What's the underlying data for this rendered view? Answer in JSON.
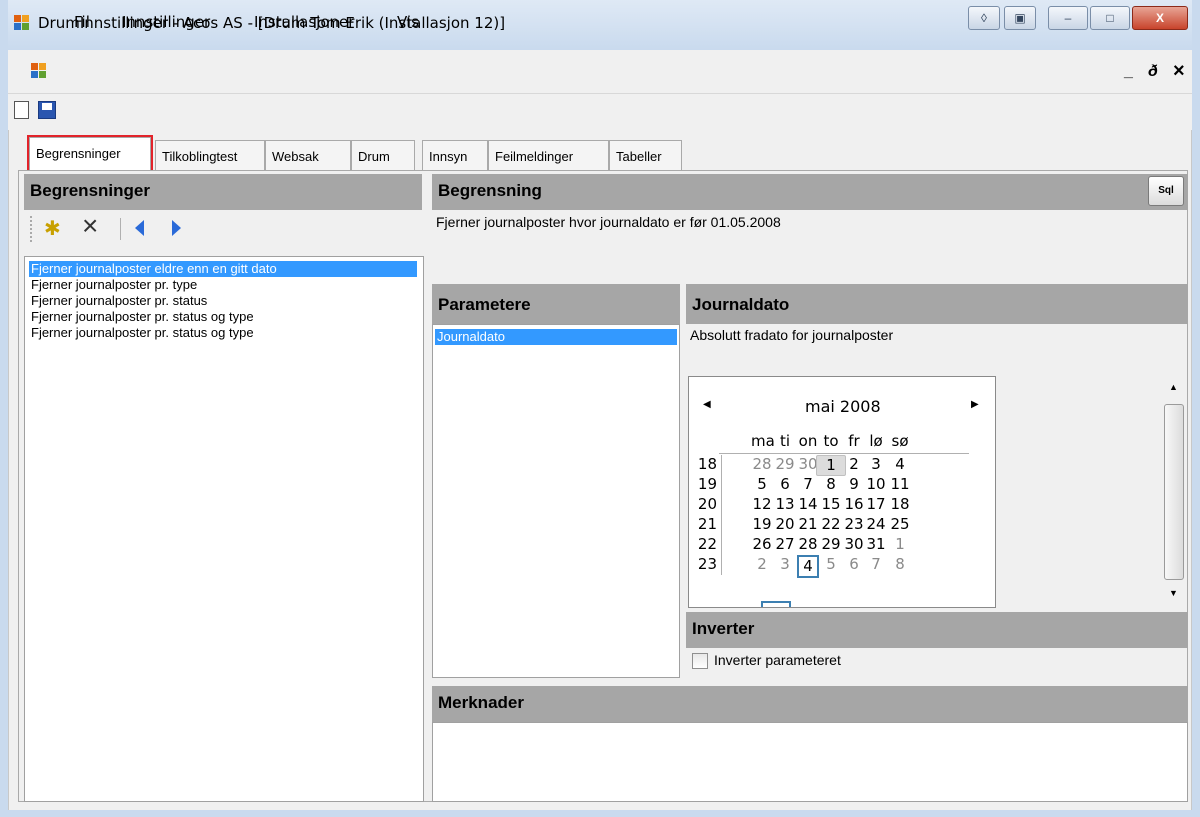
{
  "window": {
    "title": "DrumInnstillinger - Acos AS - [Drum Tom Erik (Installasjon 12)]",
    "close_glyph": "X",
    "minimize_glyph": "–",
    "maximize_glyph": "□"
  },
  "menu": {
    "items": [
      "Fil",
      "Innstillinger",
      "Installasjoner",
      "Vis"
    ],
    "mdi_controls": [
      "_",
      "ð",
      "×"
    ]
  },
  "tabs": [
    "Begrensninger",
    "Tilkoblingtest",
    "Websak",
    "Drum",
    "Innsyn",
    "Feilmeldinger",
    "Tabeller"
  ],
  "left_panel": {
    "header": "Begrensninger",
    "items": [
      "Fjerner journalposter eldre enn en gitt dato",
      "Fjerner journalposter pr. type",
      "Fjerner journalposter pr. status",
      "Fjerner journalposter pr. status og type",
      "Fjerner journalposter pr. status og type"
    ]
  },
  "begrensning": {
    "header": "Begrensning",
    "description": "Fjerner journalposter hvor journaldato er før 01.05.2008",
    "sql_button": "Sql"
  },
  "parametere": {
    "header": "Parametere",
    "items": [
      "Journaldato"
    ]
  },
  "journaldato": {
    "header": "Journaldato",
    "description": "Absolutt fradato for journalposter"
  },
  "calendar": {
    "month_label": "mai 2008",
    "day_headers": [
      "ma",
      "ti",
      "on",
      "to",
      "fr",
      "lø",
      "sø"
    ],
    "weeks": [
      {
        "week": "18",
        "days": [
          "28",
          "29",
          "30",
          "1",
          "2",
          "3",
          "4"
        ]
      },
      {
        "week": "19",
        "days": [
          "5",
          "6",
          "7",
          "8",
          "9",
          "10",
          "11"
        ]
      },
      {
        "week": "20",
        "days": [
          "12",
          "13",
          "14",
          "15",
          "16",
          "17",
          "18"
        ]
      },
      {
        "week": "21",
        "days": [
          "19",
          "20",
          "21",
          "22",
          "23",
          "24",
          "25"
        ]
      },
      {
        "week": "22",
        "days": [
          "26",
          "27",
          "28",
          "29",
          "30",
          "31",
          "1"
        ]
      },
      {
        "week": "23",
        "days": [
          "2",
          "3",
          "4",
          "5",
          "6",
          "7",
          "8"
        ]
      }
    ],
    "selected_day": "1",
    "today_day": "4"
  },
  "inverter": {
    "header": "Inverter",
    "checkbox_label": "Inverter parameteret",
    "checked": false
  },
  "merknader": {
    "header": "Merknader",
    "value": ""
  },
  "colors": {
    "selection": "#3399ff",
    "header_bg": "#a6a6a6",
    "tab_highlight": "#e2232a"
  }
}
